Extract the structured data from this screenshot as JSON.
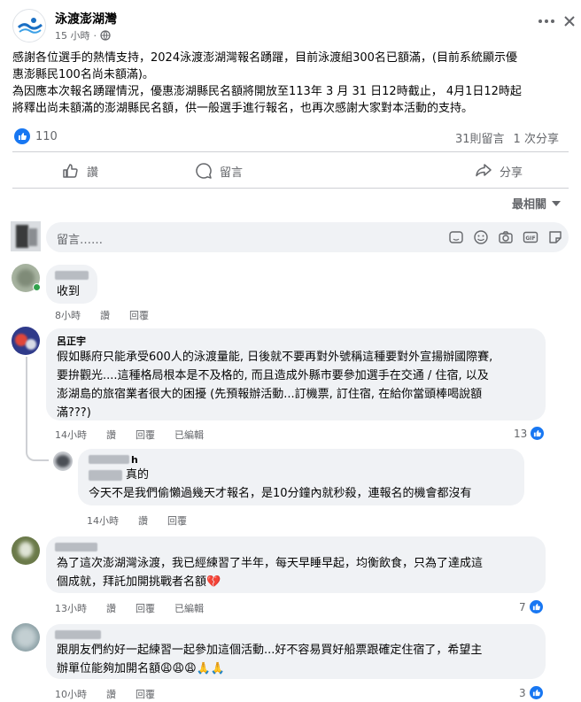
{
  "post": {
    "page_name": "泳渡澎湖灣",
    "time": "15 小時",
    "privacy_icon": "globe-icon",
    "more_icon": "ellipsis-icon",
    "close_icon": "close-icon",
    "text_lines": [
      "感謝各位選手的熱情支持，2024泳渡澎湖灣報名踴躍，目前泳渡組300名已額滿，(目前系統顯示優",
      "惠澎縣民100名尚未額滿)。",
      "為因應本次報名踴躍情況，優惠澎湖縣民名額將開放至113年 3 月 31 日12時截止， 4月1日12時起",
      "將釋出尚未額滿的澎湖縣民名額，供一般選手進行報名，也再次感謝大家對本活動的支持。"
    ],
    "reaction_count": "110",
    "comments_count": "31則留言",
    "shares_count": "1 次分享"
  },
  "actions": {
    "like": "讚",
    "comment": "留言",
    "share": "分享"
  },
  "sort": {
    "label": "最相關"
  },
  "composer": {
    "placeholder": "留言……"
  },
  "comments": [
    {
      "name": "",
      "text": [
        "收到"
      ],
      "time": "8小時",
      "like": "讚",
      "reply": "回覆",
      "edited": "",
      "likes": ""
    },
    {
      "name": "呂正宇",
      "text": [
        "假如縣府只能承受600人的泳渡量能, 日後就不要再對外號稱這種要對外宣揚辦國際賽,",
        "要拚觀光....這種格局根本是不及格的, 而且造成外縣市要參加選手在交通 / 住宿, 以及",
        "澎湖島的旅宿業者很大的困擾 (先預報辦活動...訂機票, 訂住宿, 在給你當頭棒喝說額",
        "滿???)"
      ],
      "time": "14小時",
      "like": "讚",
      "reply": "回覆",
      "edited": "已編輯",
      "likes": "13"
    },
    {
      "name": "h",
      "tag": "真的",
      "text": [
        "今天不是我們偷懶過幾天才報名，是10分鐘內就秒殺，連報名的機會都沒有"
      ],
      "time": "14小時",
      "like": "讚",
      "reply": "回覆",
      "edited": "",
      "likes": ""
    },
    {
      "name": "",
      "text": [
        "為了這次澎湖灣泳渡，我已經練習了半年，每天早睡早起，均衡飲食，只為了達成這",
        "個成就，拜託加開挑戰者名額💔"
      ],
      "time": "13小時",
      "like": "讚",
      "reply": "回覆",
      "edited": "已編輯",
      "likes": "7"
    },
    {
      "name": "",
      "text": [
        "跟朋友們約好一起練習一起參加這個活動...好不容易買好船票跟確定住宿了，希望主",
        "辦單位能夠加開名額😩😩😩🙏🙏"
      ],
      "time": "10小時",
      "like": "讚",
      "reply": "回覆",
      "edited": "",
      "likes": "3"
    }
  ]
}
